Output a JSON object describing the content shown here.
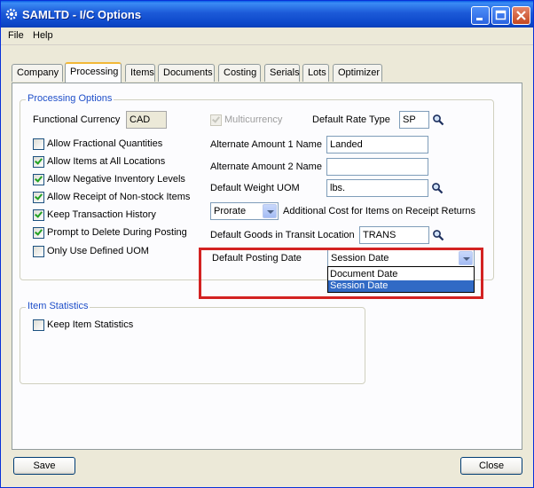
{
  "window": {
    "title": "SAMLTD - I/C Options"
  },
  "menu": {
    "file": "File",
    "help": "Help"
  },
  "tabs": [
    "Company",
    "Processing",
    "Items",
    "Documents",
    "Costing",
    "Serials",
    "Lots",
    "Optimizer"
  ],
  "active_tab": "Processing",
  "processing_options": {
    "group_title": "Processing Options",
    "functional_currency_label": "Functional Currency",
    "functional_currency_value": "CAD",
    "multicurrency_label": "Multicurrency",
    "multicurrency_checked": true,
    "default_rate_type_label": "Default Rate Type",
    "default_rate_type_value": "SP",
    "checkboxes": [
      {
        "label": "Allow Fractional Quantities",
        "checked": false
      },
      {
        "label": "Allow Items at All Locations",
        "checked": true
      },
      {
        "label": "Allow Negative Inventory Levels",
        "checked": true
      },
      {
        "label": "Allow Receipt of Non-stock Items",
        "checked": true
      },
      {
        "label": "Keep Transaction History",
        "checked": true
      },
      {
        "label": "Prompt to Delete During Posting",
        "checked": true
      },
      {
        "label": "Only Use Defined UOM",
        "checked": false
      }
    ],
    "alt_amount_1_label": "Alternate Amount 1 Name",
    "alt_amount_1_value": "Landed",
    "alt_amount_2_label": "Alternate Amount 2 Name",
    "alt_amount_2_value": "",
    "default_weight_uom_label": "Default Weight UOM",
    "default_weight_uom_value": "lbs.",
    "prorate_value": "Prorate",
    "additional_cost_label": "Additional Cost for Items on Receipt Returns",
    "goods_in_transit_label": "Default Goods in Transit Location",
    "goods_in_transit_value": "TRANS",
    "default_posting_date_label": "Default Posting Date",
    "default_posting_date_value": "Session Date",
    "posting_date_options": [
      "Document Date",
      "Session Date"
    ],
    "posting_date_selected_index": 1
  },
  "item_statistics": {
    "group_title": "Item Statistics",
    "keep_item_statistics_label": "Keep Item Statistics",
    "keep_item_statistics_checked": false
  },
  "buttons": {
    "save": "Save",
    "close": "Close"
  },
  "colors": {
    "highlight": "#d32222",
    "selection": "#316ac5",
    "group_title": "#1f4fc9"
  }
}
